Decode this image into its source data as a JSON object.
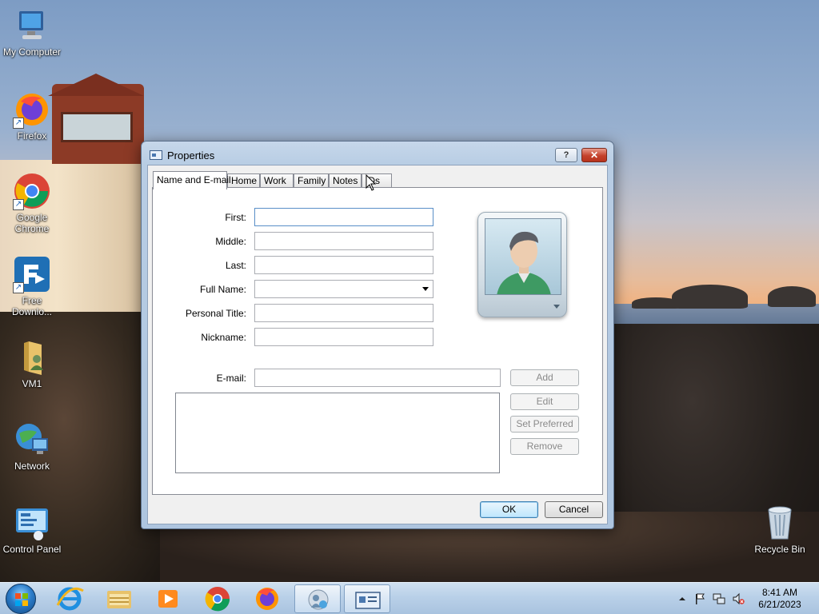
{
  "desktop": {
    "icons": [
      {
        "label": "My Computer",
        "icon": "my-computer-icon"
      },
      {
        "label": "Firefox",
        "icon": "firefox-icon"
      },
      {
        "label": "Google Chrome",
        "icon": "chrome-icon"
      },
      {
        "label": "Free Downlo...",
        "icon": "free-download-manager-icon"
      },
      {
        "label": "VM1",
        "icon": "user-folder-icon"
      },
      {
        "label": "Network",
        "icon": "network-icon"
      },
      {
        "label": "Control Panel",
        "icon": "control-panel-icon"
      },
      {
        "label": "Recycle Bin",
        "icon": "recycle-bin-icon"
      }
    ]
  },
  "dialog": {
    "title": "Properties",
    "help_label": "?",
    "close_label": "✕",
    "tabs": [
      {
        "label": "Name and E-mail",
        "active": true
      },
      {
        "label": "Home"
      },
      {
        "label": "Work"
      },
      {
        "label": "Family"
      },
      {
        "label": "Notes"
      },
      {
        "label": "IDs"
      }
    ],
    "fields": {
      "first_label": "First:",
      "first_value": "",
      "middle_label": "Middle:",
      "middle_value": "",
      "last_label": "Last:",
      "last_value": "",
      "full_name_label": "Full Name:",
      "full_name_value": "",
      "personal_title_label": "Personal Title:",
      "personal_title_value": "",
      "nickname_label": "Nickname:",
      "nickname_value": "",
      "email_label": "E-mail:",
      "email_value": ""
    },
    "email_buttons": {
      "add": "Add",
      "edit": "Edit",
      "set_preferred": "Set Preferred",
      "remove": "Remove"
    },
    "footer": {
      "ok": "OK",
      "cancel": "Cancel"
    }
  },
  "taskbar": {
    "pinned": [
      "internet-explorer-icon",
      "windows-explorer-icon",
      "media-player-icon",
      "chrome-icon",
      "firefox-icon",
      "contacts-icon",
      "properties-window-icon"
    ],
    "tray": {
      "time": "8:41 AM",
      "date": "6/21/2023"
    }
  },
  "colors": {
    "accent": "#3c7fb1",
    "close_button": "#c4422c"
  }
}
